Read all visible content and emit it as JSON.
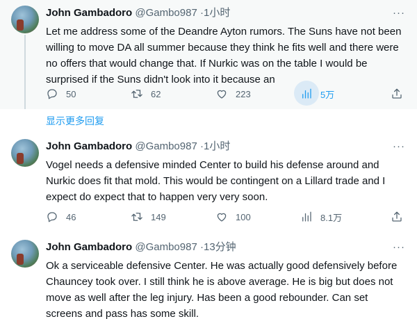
{
  "tweets": [
    {
      "name": "John Gambadoro",
      "handle": "@Gambo987",
      "dot": "·",
      "time": "1小时",
      "text": "Let me address some of the Deandre Ayton rumors. The  Suns have not been willing to move DA all summer because they think he fits well and there were no offers that would change that. If Nurkic was on the table I would be surprised if the Suns didn't look into it because an",
      "replies": "50",
      "retweets": "62",
      "likes": "223",
      "views": "5万"
    },
    {
      "name": "John Gambadoro",
      "handle": "@Gambo987",
      "dot": "·",
      "time": "1小时",
      "text": "Vogel needs a defensive minded Center to build his defense around and Nurkic does fit that mold. This would be contingent on a Lillard trade and I expect do expect that to happen very very soon.",
      "replies": "46",
      "retweets": "149",
      "likes": "100",
      "views": "8.1万"
    },
    {
      "name": "John Gambadoro",
      "handle": "@Gambo987",
      "dot": "·",
      "time": "13分钟",
      "text": "Ok a serviceable defensive Center. He was actually good defensively before Chauncey took over. I still think he is above average. He is big but does not move as well after the leg injury. Has been a good rebounder. Can set screens and pass has some skill."
    }
  ],
  "show_more_replies": "显示更多回复",
  "more_icon": "···",
  "icons": [
    "reply-icon",
    "retweet-icon",
    "like-icon",
    "views-icon",
    "share-icon",
    "more-icon"
  ],
  "accent_color": "#1d9bf0"
}
